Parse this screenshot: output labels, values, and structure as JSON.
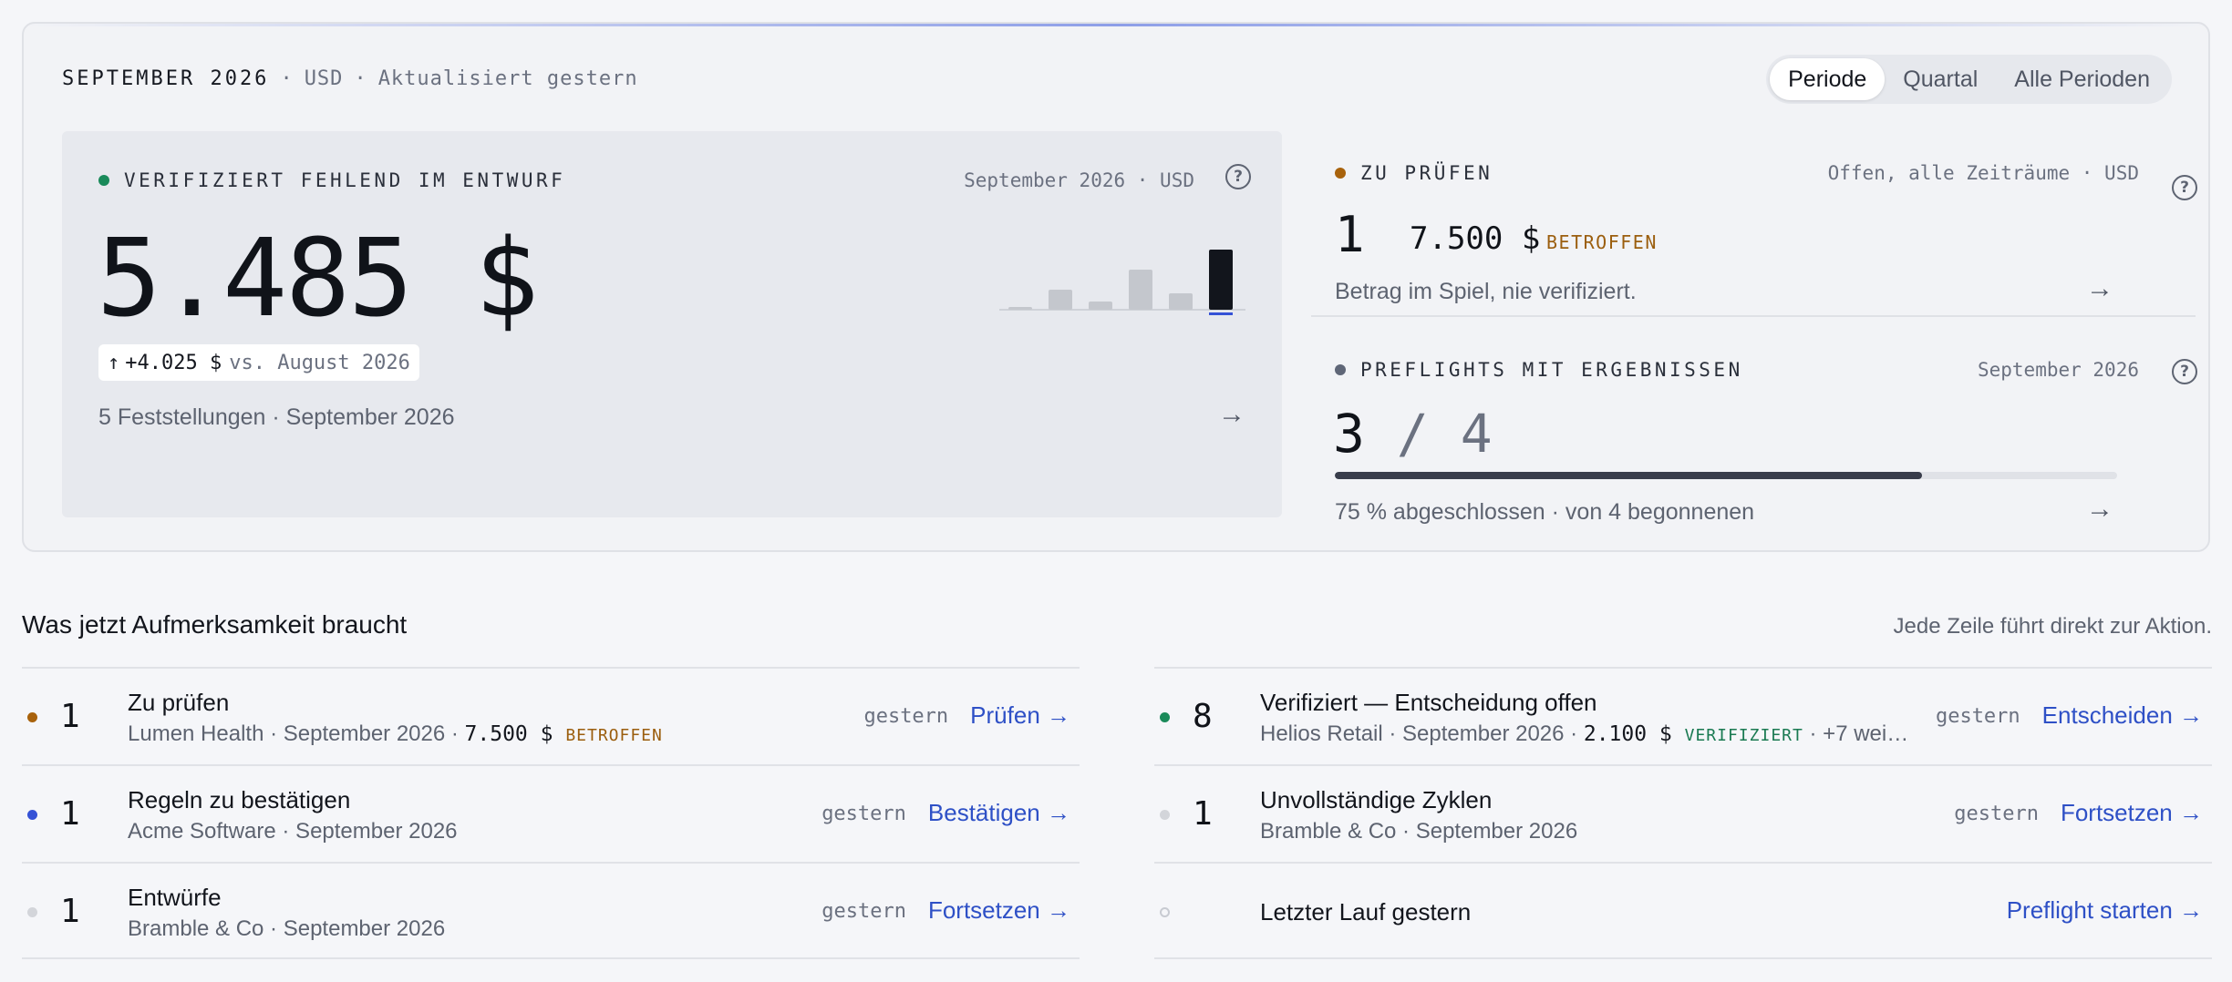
{
  "header": {
    "month": "SEPTEMBER 2026",
    "currency": "USD",
    "updated": "Aktualisiert gestern",
    "separator": "·"
  },
  "period_toggle": {
    "options": [
      "Periode",
      "Quartal",
      "Alle Perioden"
    ],
    "selected": "Periode"
  },
  "hero": {
    "label": "VERIFIZIERT FEHLEND IM ENTWURF",
    "scope": "September 2026 · USD",
    "help_glyph": "?",
    "value": "5.485 $",
    "delta": "+4.025 $",
    "delta_arrow": "↑",
    "comparison": "vs. August 2026",
    "findings": "5 Feststellungen · September 2026",
    "arrow": "→",
    "dot_color": "#1a8a5a",
    "sparkline": [
      3,
      22,
      9,
      44,
      18,
      66
    ],
    "sparkline_highlight_index": 5
  },
  "review": {
    "label": "ZU PRÜFEN",
    "scope": "Offen, alle Zeiträume · USD",
    "count": "1",
    "amount": "7.500 $",
    "tag": "BETROFFEN",
    "subtitle": "Betrag im Spiel, nie verifiziert.",
    "arrow": "→",
    "dot_color": "#a8620c"
  },
  "preflights": {
    "label": "PREFLIGHTS MIT ERGEBNISSEN",
    "scope": "September 2026",
    "done": "3",
    "slash": " / ",
    "total": "4",
    "progress": 0.75,
    "subtitle": "75 % abgeschlossen · von 4 begonnenen",
    "arrow": "→",
    "dot_color": "#5f6677"
  },
  "attention": {
    "title": "Was jetzt Aufmerksamkeit braucht",
    "hint": "Jede Zeile führt direkt zur Aktion.",
    "left": [
      {
        "count": "1",
        "title": "Zu prüfen",
        "sub": "Lumen Health · September 2026 · ",
        "amount": "7.500 $",
        "tag": "BETROFFEN",
        "tag_color": "#9b5e0e",
        "more": "",
        "time": "gestern",
        "action": "Prüfen →",
        "dot_color": "#a8620c"
      },
      {
        "count": "1",
        "title": "Regeln zu bestätigen",
        "sub": "Acme Software · September 2026",
        "amount": "",
        "tag": "",
        "tag_color": "",
        "more": "",
        "time": "gestern",
        "action": "Bestätigen →",
        "dot_color": "#3552d6"
      },
      {
        "count": "1",
        "title": "Entwürfe",
        "sub": "Bramble & Co · September 2026",
        "amount": "",
        "tag": "",
        "tag_color": "",
        "more": "",
        "time": "gestern",
        "action": "Fortsetzen →",
        "dot_color": "#d3d5da"
      }
    ],
    "right": [
      {
        "count": "8",
        "title": "Verifiziert — Entscheidung offen",
        "sub": "Helios Retail · September 2026 · ",
        "amount": "2.100 $",
        "tag": "VERIFIZIERT",
        "tag_color": "#1a7a52",
        "more": " · +7 wei…",
        "time": "gestern",
        "action": "Entscheiden →",
        "dot_color": "#1a8a5a"
      },
      {
        "count": "1",
        "title": "Unvollständige Zyklen",
        "sub": "Bramble & Co · September 2026",
        "amount": "",
        "tag": "",
        "tag_color": "",
        "more": "",
        "time": "gestern",
        "action": "Fortsetzen →",
        "dot_color": "#d3d5da"
      },
      {
        "count": "",
        "title": "Letzter Lauf gestern",
        "sub": "",
        "amount": "",
        "tag": "",
        "tag_color": "",
        "more": "",
        "time": "",
        "action": "Preflight starten →",
        "dot_color": "hollow"
      }
    ]
  }
}
